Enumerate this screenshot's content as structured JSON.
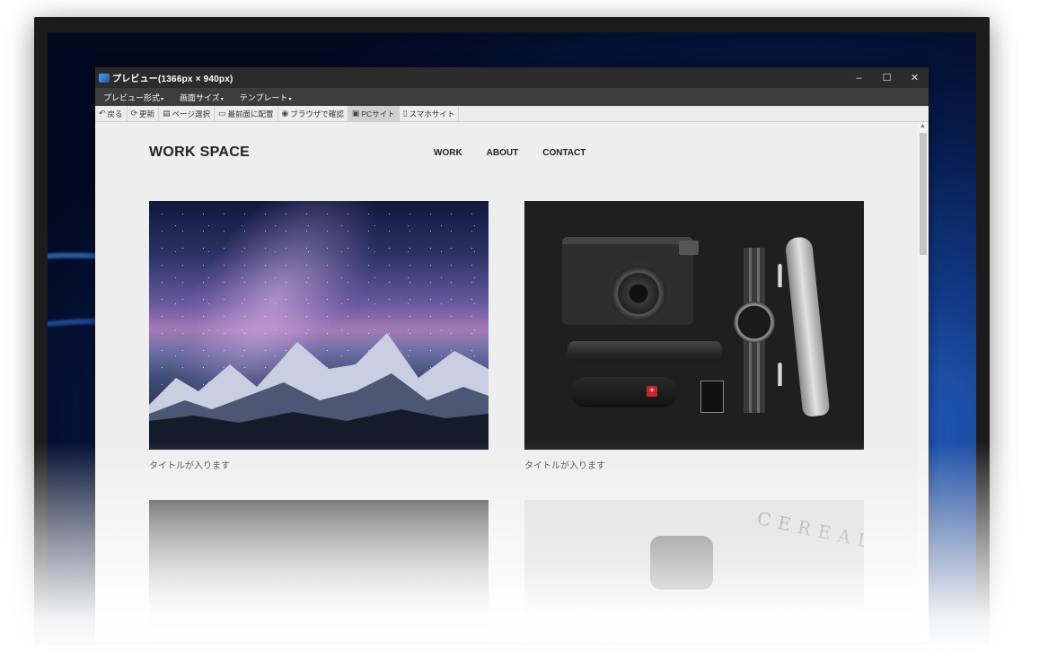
{
  "window": {
    "title": "プレビュー(1366px × 940px)",
    "controls": {
      "minimize": "–",
      "maximize": "☐",
      "close": "✕"
    }
  },
  "menubar": {
    "items": [
      {
        "label": "プレビュー形式",
        "caret": "▾"
      },
      {
        "label": "画面サイズ",
        "caret": "▾"
      },
      {
        "label": "テンプレート",
        "caret": "▾"
      }
    ]
  },
  "toolbar": {
    "items": [
      {
        "label": "戻る",
        "icon": "back-arrow-icon",
        "glyph": "↶"
      },
      {
        "label": "更新",
        "icon": "refresh-icon",
        "glyph": "⟳"
      },
      {
        "label": "ページ選択",
        "icon": "page-select-icon",
        "glyph": "▤"
      },
      {
        "label": "最前面に配置",
        "icon": "window-front-icon",
        "glyph": "▭"
      },
      {
        "label": "ブラウザで確認",
        "icon": "globe-icon",
        "glyph": "◉"
      },
      {
        "label": "PCサイト",
        "icon": "desktop-icon",
        "glyph": "▣",
        "active": true
      },
      {
        "label": "スマホサイト",
        "icon": "smartphone-icon",
        "glyph": "▯"
      }
    ]
  },
  "site": {
    "logo": "WORK SPACE",
    "nav": [
      "WORK",
      "ABOUT",
      "CONTACT"
    ],
    "cards": [
      {
        "caption": "タイトルが入ります"
      },
      {
        "caption": "タイトルが入ります"
      }
    ],
    "row2_overlay_text": "CEREAL"
  },
  "colors": {
    "titlebar": "#2b2b2b",
    "menubar": "#3c3c3c",
    "toolbar": "#ececec",
    "preview_bg": "#eeeeee"
  }
}
